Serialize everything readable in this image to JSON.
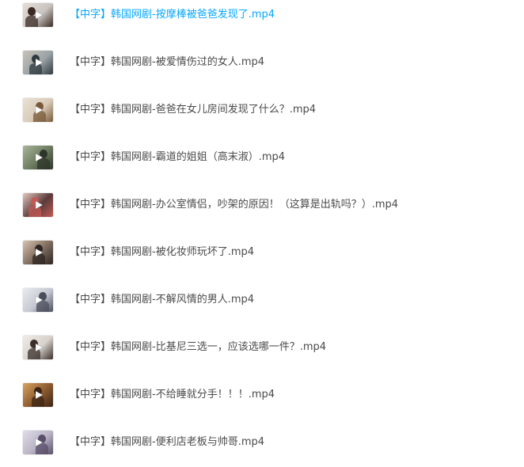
{
  "files": [
    {
      "name": "【中字】韩国网剧-按摩棒被爸爸发现了.mp4",
      "thumb_icon": "video-thumbnail-icon",
      "colors": [
        "#c9c4c0",
        "#3b2a24",
        "#e6dcd6"
      ]
    },
    {
      "name": "【中字】韩国网剧-被爱情伤过的女人.mp4",
      "thumb_icon": "video-thumbnail-icon",
      "colors": [
        "#9aa3a6",
        "#2f3a3f",
        "#c8c2b8"
      ]
    },
    {
      "name": "【中字】韩国网剧-爸爸在女儿房间发现了什么？.mp4",
      "thumb_icon": "video-thumbnail-icon",
      "colors": [
        "#d9cbb8",
        "#7a5a3a",
        "#e9e2d5"
      ]
    },
    {
      "name": "【中字】韩国网剧-霸道的姐姐（高末淑）.mp4",
      "thumb_icon": "video-thumbnail-icon",
      "colors": [
        "#6b7a5e",
        "#2e3529",
        "#a9b59a"
      ]
    },
    {
      "name": "【中字】韩国网剧-办公室情侣，吵架的原因！（这算是出轨吗？）.mp4",
      "thumb_icon": "video-thumbnail-icon",
      "colors": [
        "#5a3b3a",
        "#c45a55",
        "#e4c7bf"
      ]
    },
    {
      "name": "【中字】韩国网剧-被化妆师玩坏了.mp4",
      "thumb_icon": "video-thumbnail-icon",
      "colors": [
        "#7c6a5c",
        "#2d2522",
        "#d8c3b1"
      ]
    },
    {
      "name": "【中字】韩国网剧-不解风情的男人.mp4",
      "thumb_icon": "video-thumbnail-icon",
      "colors": [
        "#c6c9d2",
        "#4a4e5c",
        "#e9ebef"
      ]
    },
    {
      "name": "【中字】韩国网剧-比基尼三选一，应该选哪一件？.mp4",
      "thumb_icon": "video-thumbnail-icon",
      "colors": [
        "#d7d2cc",
        "#3a2f2a",
        "#f0ebe6"
      ]
    },
    {
      "name": "【中字】韩国网剧-不给睡就分手！！！.mp4",
      "thumb_icon": "video-thumbnail-icon",
      "colors": [
        "#8a5a2e",
        "#3b2414",
        "#d9a35f"
      ]
    },
    {
      "name": "【中字】韩国网剧-便利店老板与帅哥.mp4",
      "thumb_icon": "video-thumbnail-icon",
      "colors": [
        "#b8b4c4",
        "#5a4e6a",
        "#e0dce8"
      ]
    }
  ]
}
